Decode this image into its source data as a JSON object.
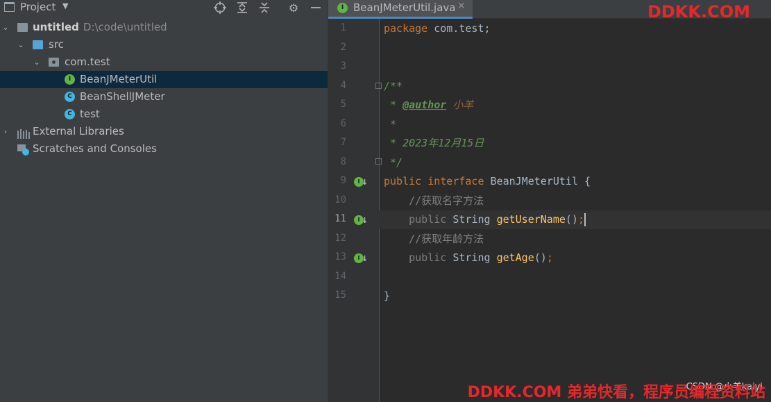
{
  "project_panel": {
    "title": "Project",
    "tree": [
      {
        "label": "untitled",
        "path": "D:\\code\\untitled"
      },
      {
        "label": "src"
      },
      {
        "label": "com.test"
      },
      {
        "label": "BeanJMeterUtil"
      },
      {
        "label": "BeanShellJMeter"
      },
      {
        "label": "test"
      },
      {
        "label": "External Libraries"
      },
      {
        "label": "Scratches and Consoles"
      }
    ]
  },
  "editor": {
    "tab_label": "BeanJMeterUtil.java",
    "line_numbers": [
      "1",
      "2",
      "3",
      "4",
      "5",
      "6",
      "7",
      "8",
      "9",
      "10",
      "11",
      "12",
      "13",
      "14",
      "15"
    ],
    "current_line": "11",
    "code": {
      "l1_kw": "package",
      "l1_rest": " com.test;",
      "l4": "/**",
      "l5_star": " * ",
      "l5_tag": "@author",
      "l5_val": " 小羊",
      "l6": " *",
      "l7": " * 2023年12月15日",
      "l8": " */",
      "l9_kw": "public interface",
      "l9_rest": " BeanJMeterUtil {",
      "l10": "    //获取名字方法",
      "l11_kw": "    public",
      "l11_type": " String ",
      "l11_method": "getUserName",
      "l11_paren": "()",
      "l11_semi": ";",
      "l12": "    //获取年龄方法",
      "l13_kw": "    public",
      "l13_type": " String ",
      "l13_method": "getAge",
      "l13_paren": "()",
      "l13_semi": ";",
      "l15": "}"
    }
  },
  "icons": {
    "interface_badge": "I",
    "class_badge": "C"
  },
  "watermarks": {
    "top": "DDKK.COM",
    "bottom": "DDKK.COM 弟弟快看，程序员编程资料站",
    "csdn": "CSDN @小羊kaiyi"
  },
  "colors": {
    "background": "#2b2b2b",
    "panel": "#3c3f41",
    "selection": "#0d293e",
    "keyword": "#cc7832",
    "method": "#ffc66d",
    "doc_comment": "#629755",
    "watermark": "#e8272a"
  }
}
